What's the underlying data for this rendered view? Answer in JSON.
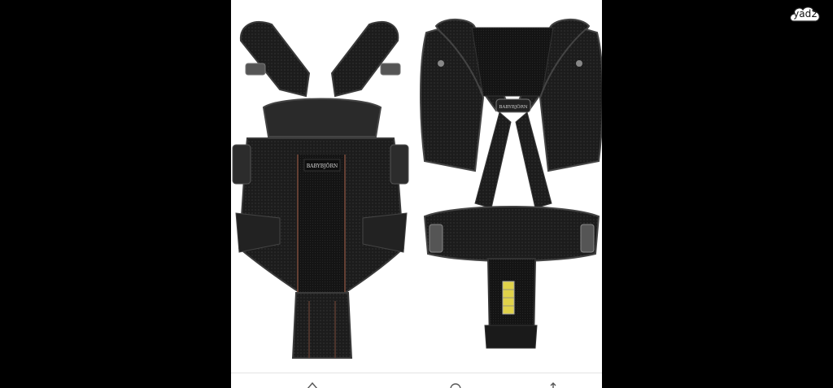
{
  "watermark": {
    "text": "yad2"
  },
  "product_photo": {
    "front_logo": "BABYBJÖRN",
    "back_logo": "BABYBJÖRN"
  },
  "bottom_bar": {
    "icons": [
      "share-icon",
      "home-icon",
      "heart-icon"
    ]
  },
  "colors": {
    "background": "#000000",
    "photo_background": "#ffffff",
    "carrier_mesh": "#1e1e1e",
    "carrier_trim": "#3a3a3a",
    "accent_stripe": "#7a4a3a",
    "size_gauge": "#e0d24a"
  }
}
